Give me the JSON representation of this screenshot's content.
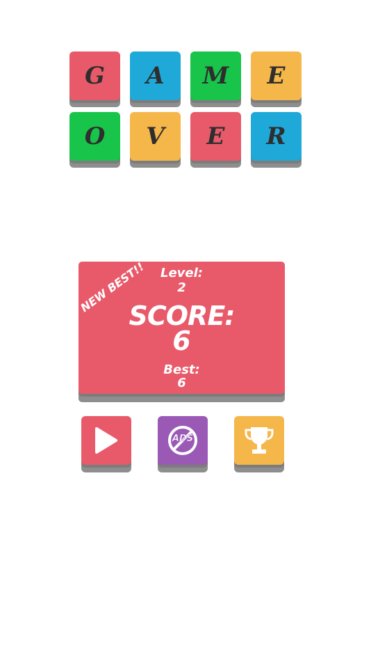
{
  "title_tiles": [
    {
      "letter": "G",
      "color": "#e85a6a"
    },
    {
      "letter": "A",
      "color": "#1fa9d9"
    },
    {
      "letter": "M",
      "color": "#18c44a"
    },
    {
      "letter": "E",
      "color": "#f5b64a"
    },
    {
      "letter": "O",
      "color": "#18c44a"
    },
    {
      "letter": "V",
      "color": "#f5b64a"
    },
    {
      "letter": "E",
      "color": "#e85a6a"
    },
    {
      "letter": "R",
      "color": "#1fa9d9"
    }
  ],
  "score_panel": {
    "color": "#e85a6a",
    "badge": "NEW BEST!!",
    "level_label": "Level:",
    "level_value": "2",
    "score_label": "SCORE:",
    "score_value": "6",
    "best_label": "Best:",
    "best_value": "6"
  },
  "buttons": {
    "play": {
      "icon": "play-icon",
      "color": "#e85a6a"
    },
    "no_ads": {
      "icon": "no-ads-icon",
      "label": "ADS",
      "color": "#9b59b6"
    },
    "leaderboard": {
      "icon": "trophy-icon",
      "color": "#f5b64a"
    }
  }
}
